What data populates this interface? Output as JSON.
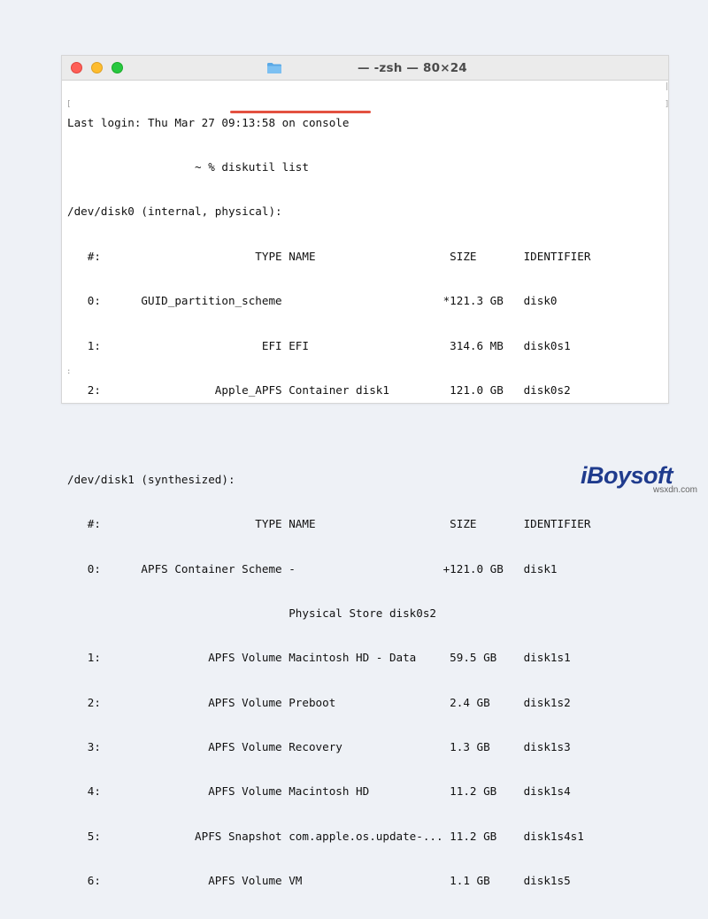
{
  "window": {
    "title": "— -zsh — 80×24"
  },
  "terminal": {
    "lines": [
      "Last login: Thu Mar 27 09:13:58 on console",
      "                   ~ % diskutil list",
      "/dev/disk0 (internal, physical):",
      "   #:                       TYPE NAME                    SIZE       IDENTIFIER",
      "   0:      GUID_partition_scheme                        *121.3 GB   disk0",
      "   1:                        EFI EFI                     314.6 MB   disk0s1",
      "   2:                 Apple_APFS Container disk1         121.0 GB   disk0s2",
      "",
      "/dev/disk1 (synthesized):",
      "   #:                       TYPE NAME                    SIZE       IDENTIFIER",
      "   0:      APFS Container Scheme -                      +121.0 GB   disk1",
      "                                 Physical Store disk0s2",
      "   1:                APFS Volume Macintosh HD - Data     59.5 GB    disk1s1",
      "   2:                APFS Volume Preboot                 2.4 GB     disk1s2",
      "   3:                APFS Volume Recovery                1.3 GB     disk1s3",
      "   4:                APFS Volume Macintosh HD            11.2 GB    disk1s4",
      "   5:              APFS Snapshot com.apple.os.update-... 11.2 GB    disk1s4s1",
      "   6:                APFS Volume VM                      1.1 GB     disk1s5"
    ]
  },
  "watermark": {
    "brand": "iBoysoft",
    "site": "wsxdn.com"
  },
  "colors": {
    "highlight": "#e35140",
    "brand": "#1f3b8d"
  },
  "icons": [
    "close-icon",
    "minimize-icon",
    "zoom-icon",
    "folder-icon"
  ]
}
